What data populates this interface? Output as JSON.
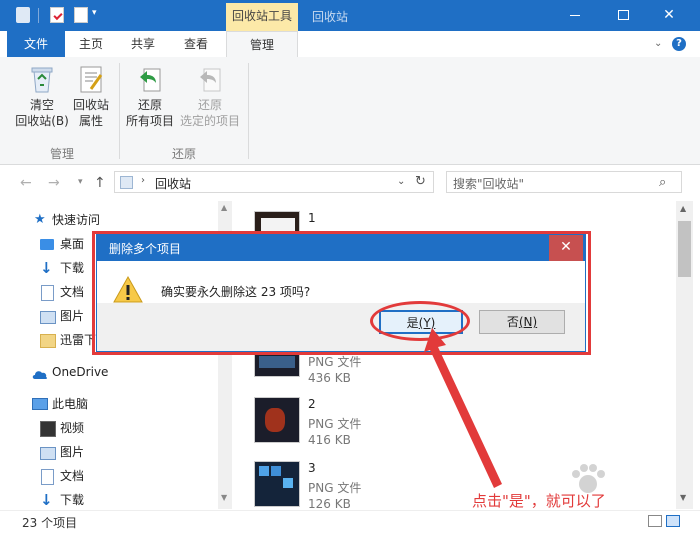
{
  "titlebar": {
    "context_tab": "回收站工具",
    "window_title": "回收站"
  },
  "ribbon_tabs": {
    "file": "文件",
    "home": "主页",
    "share": "共享",
    "view": "查看",
    "manage": "管理"
  },
  "ribbon": {
    "empty_bin_line1": "清空",
    "empty_bin_line2": "回收站(B)",
    "props_line1": "回收站",
    "props_line2": "属性",
    "restore_all_line1": "还原",
    "restore_all_line2": "所有项目",
    "restore_sel_line1": "还原",
    "restore_sel_line2": "选定的项目",
    "group_manage": "管理",
    "group_restore": "还原"
  },
  "address": {
    "path": "回收站",
    "search_placeholder": "搜索\"回收站\""
  },
  "nav": {
    "quick_access": "快速访问",
    "desktop": "桌面",
    "downloads": "下载",
    "documents": "文档",
    "pictures": "图片",
    "xunlei": "迅雷下",
    "onedrive": "OneDrive",
    "this_pc": "此电脑",
    "videos": "视频",
    "pictures2": "图片",
    "documents2": "文档",
    "downloads2": "下载"
  },
  "files": [
    {
      "name": "1",
      "type": "PNG 文件",
      "size": ""
    },
    {
      "name": "",
      "type": "PNG 文件",
      "size": "436 KB"
    },
    {
      "name": "2",
      "type": "PNG 文件",
      "size": "416 KB"
    },
    {
      "name": "3",
      "type": "PNG 文件",
      "size": "126 KB"
    }
  ],
  "status": {
    "count": "23 个项目"
  },
  "dialog": {
    "title": "删除多个项目",
    "close": "✕",
    "message": "确实要永久删除这 23 项吗?",
    "yes_text": "是",
    "yes_key": "(Y)",
    "no_text": "否",
    "no_key": "(N)"
  },
  "annotation": {
    "text": "点击\"是\"，就可以了"
  },
  "colors": {
    "accent": "#1f6fc5",
    "context_tab": "#fce9a8",
    "annotation": "#e23a3a",
    "dialog_close": "#c75050"
  },
  "icons": [
    "recycle-bin-icon",
    "properties-icon",
    "restore-icon",
    "warning-icon",
    "search-icon",
    "star-icon",
    "desktop-icon",
    "download-icon",
    "document-icon",
    "picture-icon",
    "folder-icon",
    "cloud-icon",
    "computer-icon",
    "video-icon"
  ]
}
